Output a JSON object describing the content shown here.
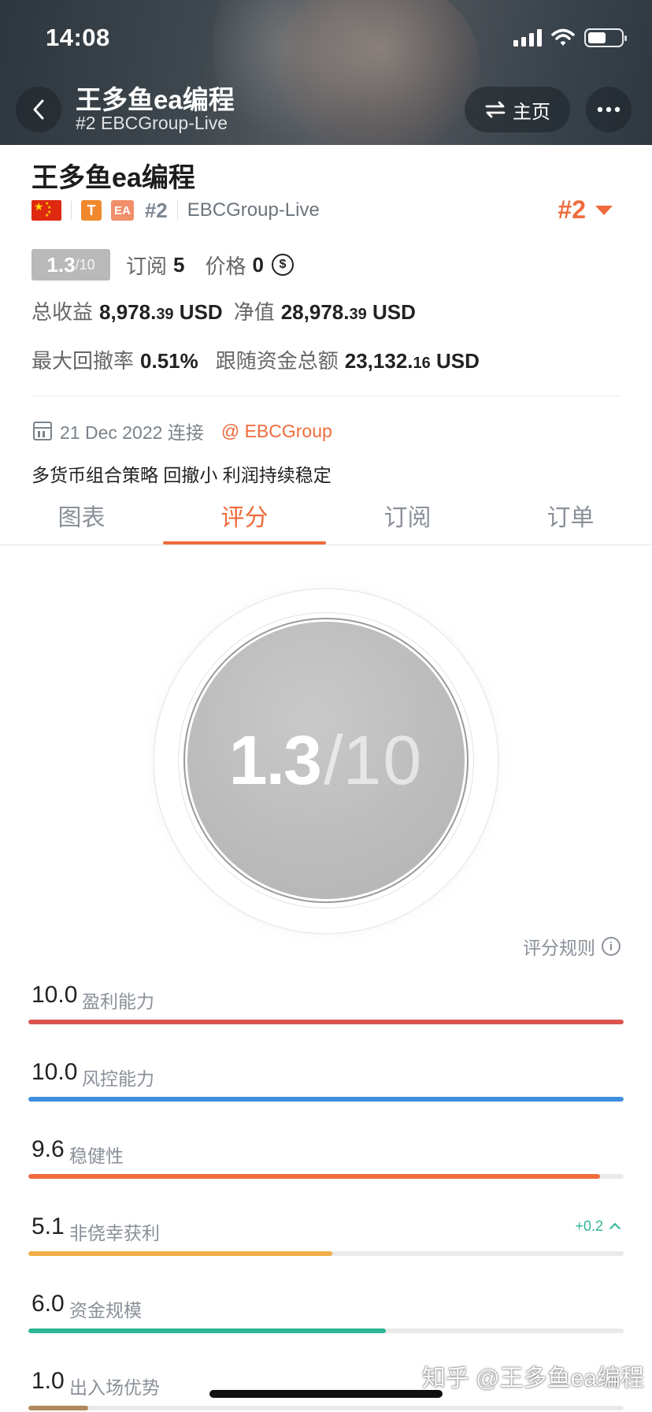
{
  "status_bar": {
    "time": "14:08"
  },
  "nav": {
    "title": "王多鱼ea编程",
    "subtitle": "#2 EBCGroup-Live",
    "home_label": "主页"
  },
  "info": {
    "title": "王多鱼ea编程",
    "tag_t": "T",
    "tag_ea": "EA",
    "rank_small": "#2",
    "broker": "EBCGroup-Live",
    "rank_big": "#2",
    "score_main": "1.3",
    "score_of": "/10",
    "subscribe_label": "订阅",
    "subscribe_value": "5",
    "price_label": "价格",
    "price_value": "0",
    "coin_symbol": "$",
    "total_profit_label": "总收益",
    "total_profit_int": "8,978.",
    "total_profit_dec": "39",
    "currency": "USD",
    "net_value_label": "净值",
    "net_value_int": "28,978.",
    "net_value_dec": "39",
    "max_drawdown_label": "最大回撤率",
    "max_drawdown_value": "0.51%",
    "follow_funds_label": "跟随资金总额",
    "follow_funds_int": "23,132.",
    "follow_funds_dec": "16",
    "connect_date": "21 Dec 2022 连接",
    "at_broker": "@ EBCGroup",
    "description": "多货币组合策略 回撤小 利润持续稳定"
  },
  "tabs": [
    {
      "label": "图表",
      "active": false
    },
    {
      "label": "评分",
      "active": true
    },
    {
      "label": "订阅",
      "active": false
    },
    {
      "label": "订单",
      "active": false
    }
  ],
  "score_circle": {
    "value": "1.3",
    "slash": "/",
    "max": "10"
  },
  "rules_label": "评分规则",
  "metrics": [
    {
      "value": "10.0",
      "label": "盈利能力",
      "score": 10.0,
      "color": "#d9534f"
    },
    {
      "value": "10.0",
      "label": "风控能力",
      "score": 10.0,
      "color": "#3f8ee0"
    },
    {
      "value": "9.6",
      "label": "稳健性",
      "score": 9.6,
      "color": "#ef6b3c"
    },
    {
      "value": "5.1",
      "label": "非侥幸获利",
      "score": 5.1,
      "color": "#f0ae45",
      "delta": "+0.2"
    },
    {
      "value": "6.0",
      "label": "资金规模",
      "score": 6.0,
      "color": "#2fb597"
    },
    {
      "value": "1.0",
      "label": "出入场优势",
      "score": 1.0,
      "color": "#b08a5a"
    }
  ],
  "watermark": "知乎 @王多鱼ea编程",
  "colors": {
    "accent": "#ef6b3c",
    "score_gray": "#b9b9b9"
  }
}
